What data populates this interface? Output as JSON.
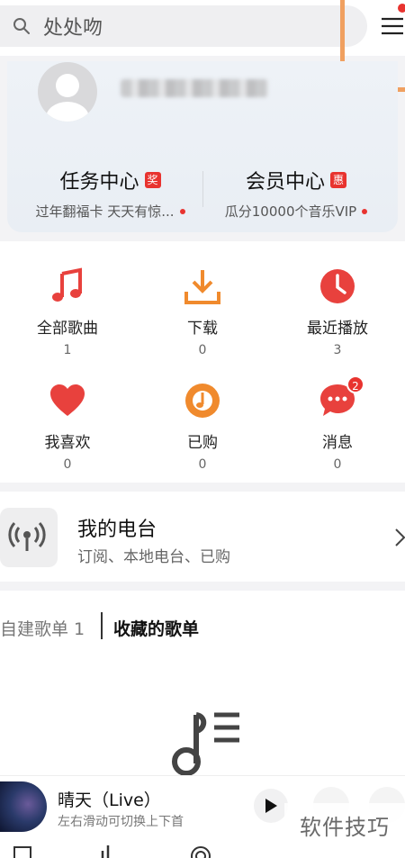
{
  "search": {
    "placeholder": "处处吻",
    "icon": "search-icon"
  },
  "header": {
    "menu_icon": "hamburger-menu-icon",
    "accent_dot": "#e8332f",
    "highlight_box_color": "#f0a060"
  },
  "profile": {
    "task_center": {
      "title": "任务中心",
      "badge": "奖",
      "subtitle": "过年翻福卡 天天有惊..."
    },
    "vip_center": {
      "title": "会员中心",
      "badge": "惠",
      "subtitle": "瓜分10000个音乐VIP"
    }
  },
  "grid": [
    {
      "label": "全部歌曲",
      "count": "1",
      "icon": "music-note-icon",
      "color": "#e8413d"
    },
    {
      "label": "下载",
      "count": "0",
      "icon": "download-icon",
      "color": "#f08a2d"
    },
    {
      "label": "最近播放",
      "count": "3",
      "icon": "clock-icon",
      "color": "#e8413d"
    },
    {
      "label": "我喜欢",
      "count": "0",
      "icon": "heart-icon",
      "color": "#e8413d"
    },
    {
      "label": "已购",
      "count": "0",
      "icon": "purchased-disc-icon",
      "color": "#f08a2d"
    },
    {
      "label": "消息",
      "count": "0",
      "icon": "message-icon",
      "color": "#e8413d",
      "badge": "2"
    }
  ],
  "radio": {
    "title": "我的电台",
    "subtitle": "订阅、本地电台、已购"
  },
  "playlist_tabs": {
    "created": "自建歌单 1",
    "favorited": "收藏的歌单"
  },
  "player": {
    "song": "晴天（Live）",
    "hint": "左右滑动可切换上下首"
  },
  "watermark": "软件技巧"
}
